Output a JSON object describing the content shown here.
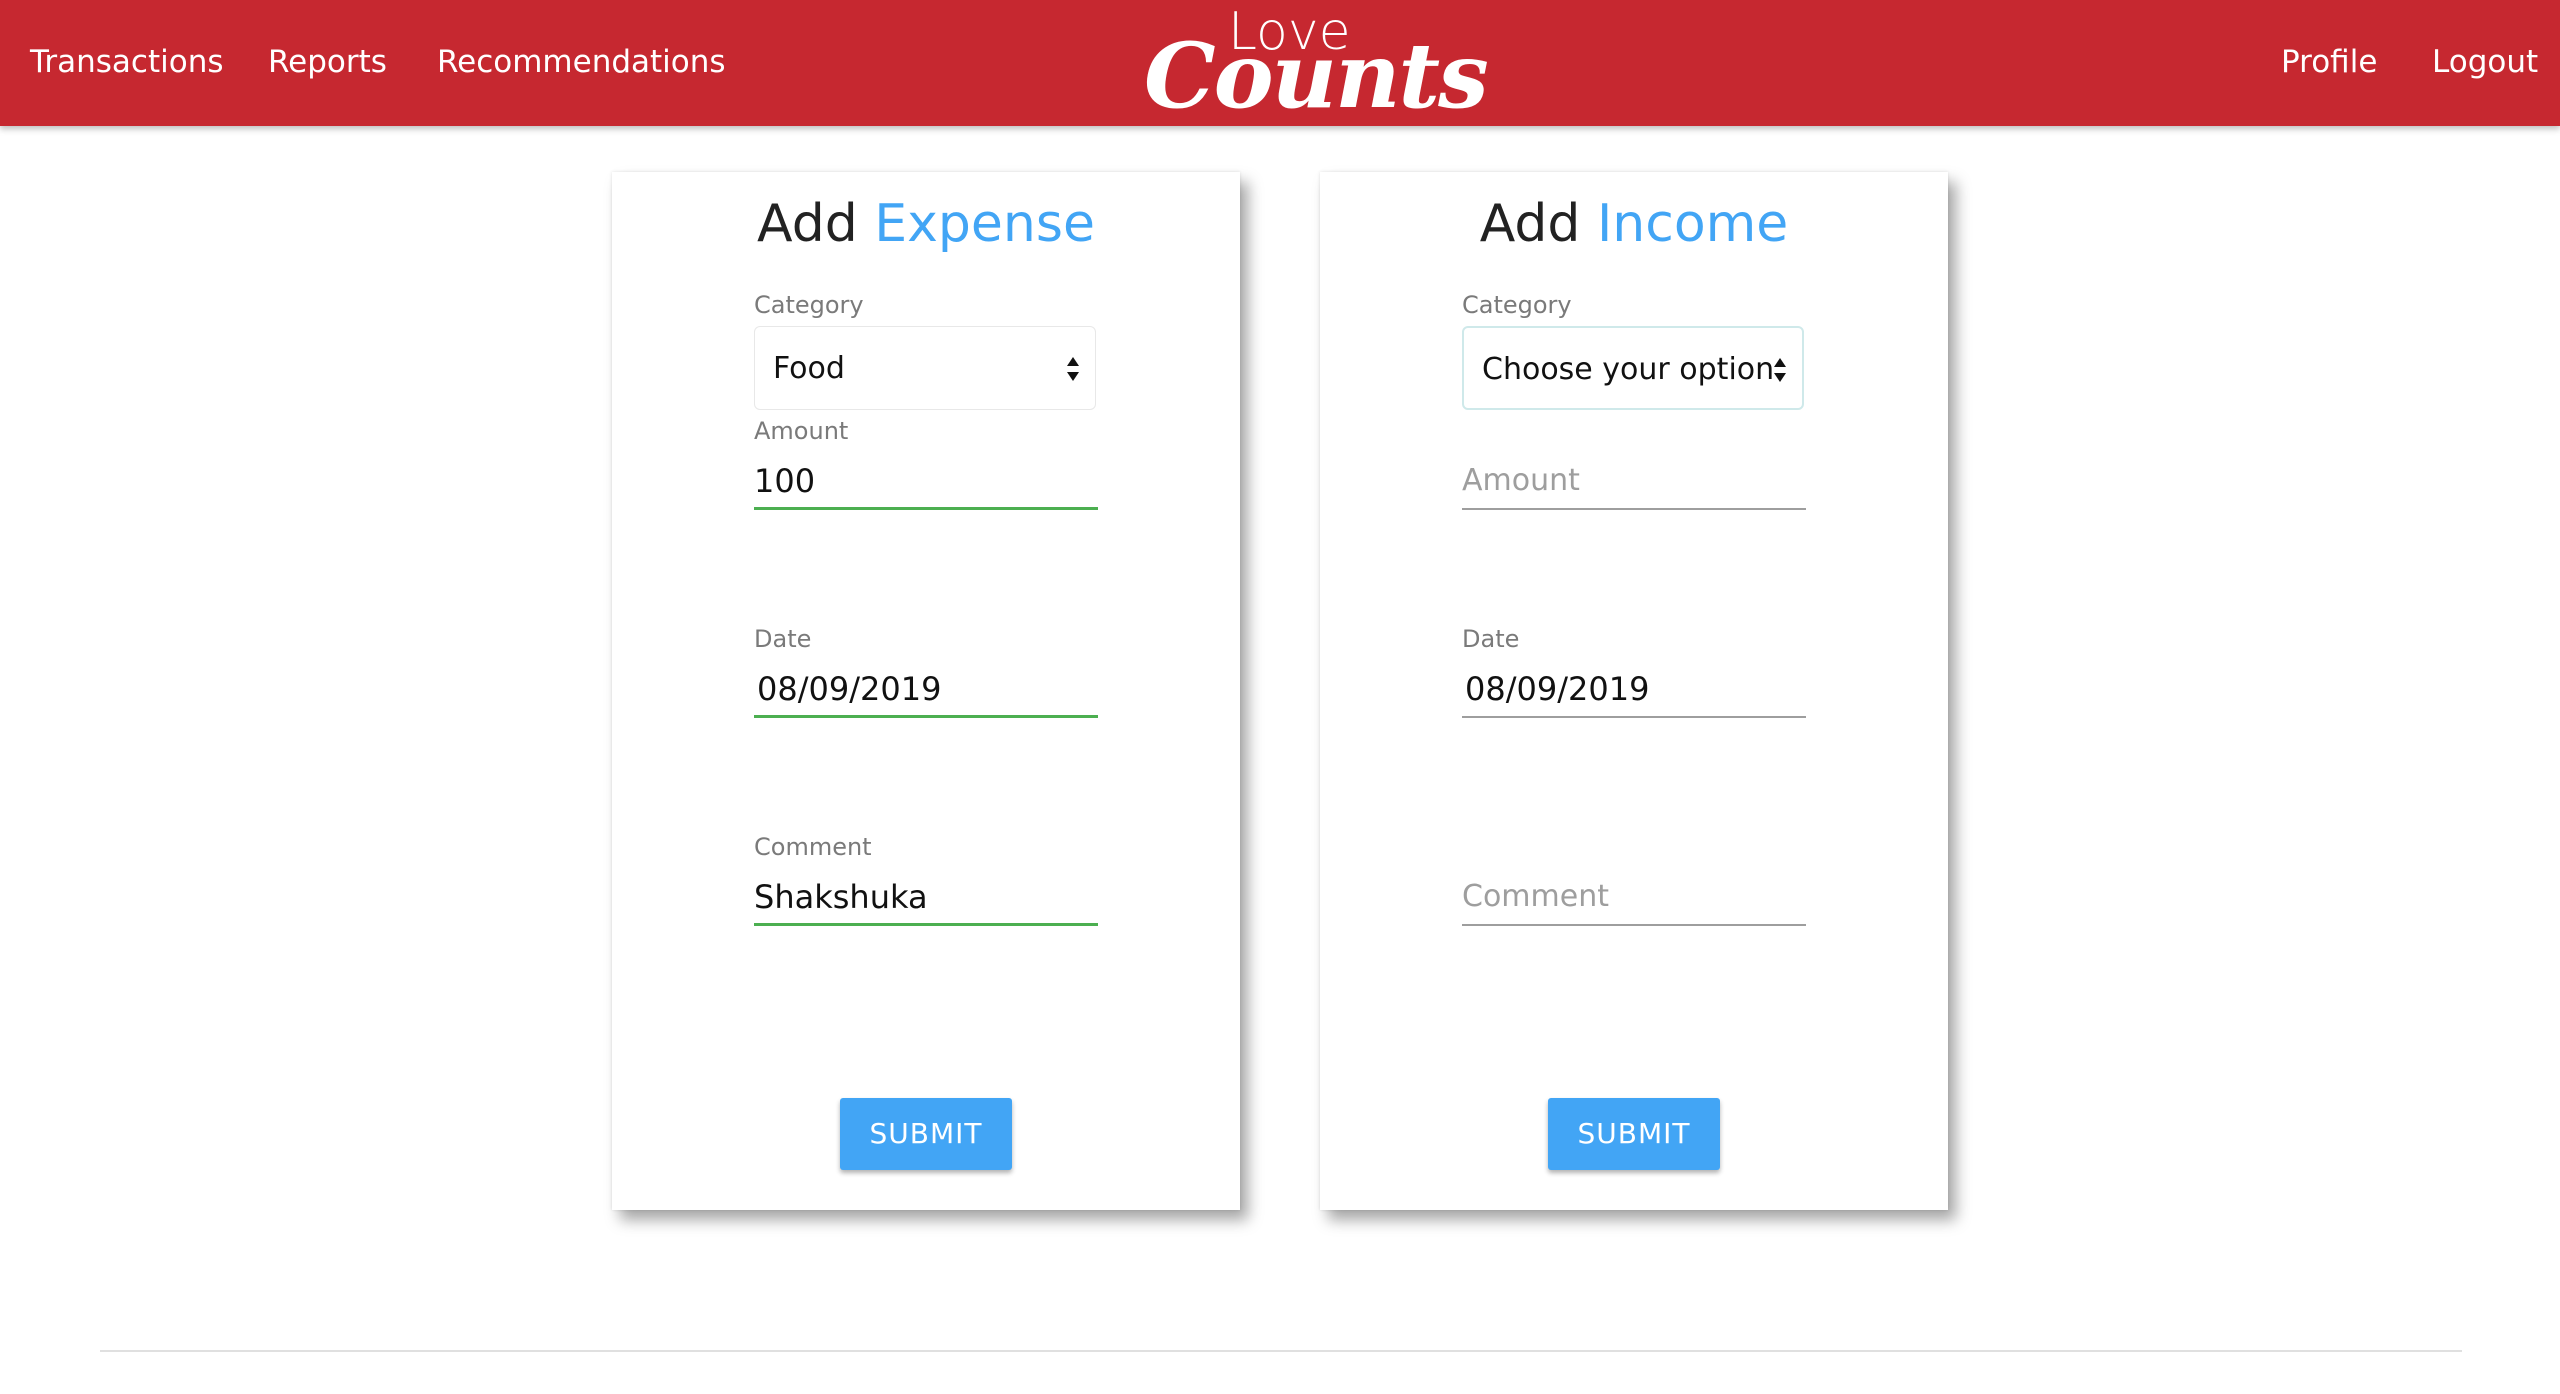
{
  "nav": {
    "transactions": "Transactions",
    "reports": "Reports",
    "recommendations": "Recommendations",
    "profile": "Profile",
    "logout": "Logout"
  },
  "logo": {
    "top": "Love",
    "bottom": "Counts"
  },
  "expense_card": {
    "title_main": "Add",
    "title_accent": "Expense",
    "category_label": "Category",
    "category_value": "Food",
    "amount_label": "Amount",
    "amount_value": "100",
    "date_label": "Date",
    "date_value": "08/09/2019",
    "comment_label": "Comment",
    "comment_value": "Shakshuka",
    "submit_label": "SUBMIT"
  },
  "income_card": {
    "title_main": "Add",
    "title_accent": "Income",
    "category_label": "Category",
    "category_value": "Choose your option",
    "amount_placeholder": "Amount",
    "date_label": "Date",
    "date_value": "08/09/2019",
    "comment_placeholder": "Comment",
    "submit_label": "SUBMIT"
  },
  "colors": {
    "navbar": "#c62830",
    "accent": "#42a5f5",
    "valid_underline": "#4caf50"
  }
}
